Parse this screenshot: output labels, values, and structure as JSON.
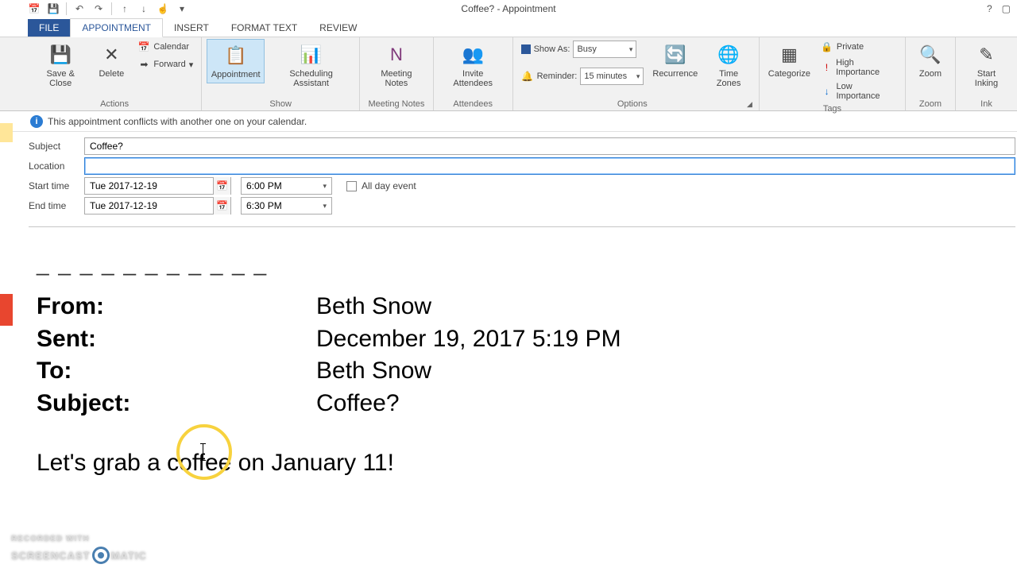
{
  "window": {
    "title": "Coffee? - Appointment"
  },
  "tabs": {
    "file": "FILE",
    "appointment": "APPOINTMENT",
    "insert": "INSERT",
    "format_text": "FORMAT TEXT",
    "review": "REVIEW"
  },
  "ribbon": {
    "actions": {
      "label": "Actions",
      "save_close": "Save & Close",
      "delete": "Delete",
      "calendar": "Calendar",
      "forward": "Forward"
    },
    "show": {
      "label": "Show",
      "appointment": "Appointment",
      "scheduling": "Scheduling Assistant"
    },
    "meeting_notes": {
      "label": "Meeting Notes",
      "btn": "Meeting Notes"
    },
    "attendees": {
      "label": "Attendees",
      "btn": "Invite Attendees"
    },
    "options": {
      "label": "Options",
      "show_as_label": "Show As:",
      "show_as_value": "Busy",
      "reminder_label": "Reminder:",
      "reminder_value": "15 minutes",
      "recurrence": "Recurrence",
      "time_zones": "Time Zones"
    },
    "tags": {
      "label": "Tags",
      "categorize": "Categorize",
      "private": "Private",
      "high": "High Importance",
      "low": "Low Importance"
    },
    "zoom": {
      "label": "Zoom",
      "btn": "Zoom"
    },
    "ink": {
      "label": "Ink",
      "btn": "Start Inking"
    }
  },
  "infobar": "This appointment conflicts with another one on your calendar.",
  "form": {
    "subject_label": "Subject",
    "subject_value": "Coffee?",
    "location_label": "Location",
    "location_value": "",
    "start_label": "Start time",
    "start_date": "Tue 2017-12-19",
    "start_time": "6:00 PM",
    "end_label": "End time",
    "end_date": "Tue 2017-12-19",
    "end_time": "6:30 PM",
    "all_day": "All day event"
  },
  "body": {
    "from_label": "From:",
    "from_value": "Beth Snow",
    "sent_label": "Sent:",
    "sent_value": "December 19, 2017 5:19 PM",
    "to_label": "To:",
    "to_value": "Beth Snow",
    "subject_label": "Subject:",
    "subject_value": "Coffee?",
    "message": "Let's grab a coffee on January 11!"
  },
  "watermark": {
    "line1": "RECORDED WITH",
    "line2a": "SCREENCAST",
    "line2b": "MATIC"
  }
}
